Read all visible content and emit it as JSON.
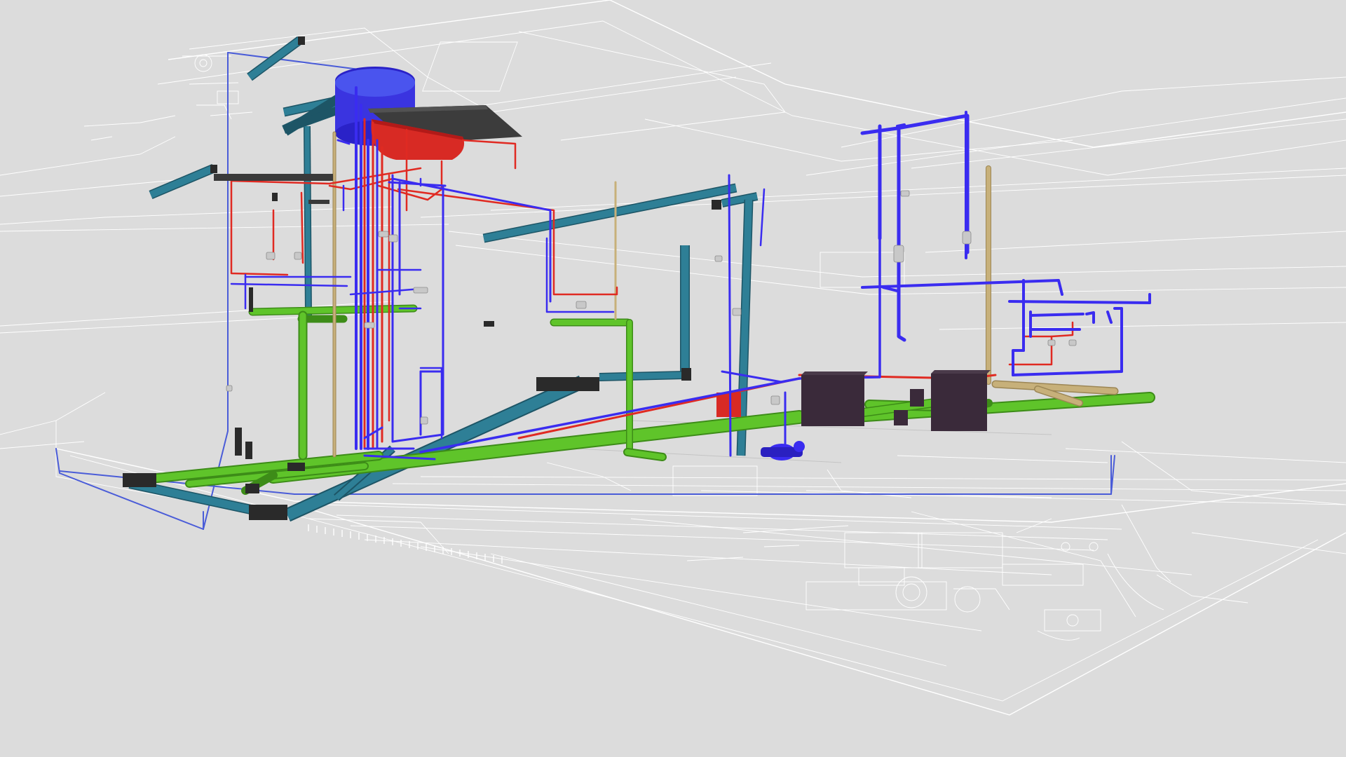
{
  "viewer": {
    "view": "3d-perspective"
  },
  "systems": [
    {
      "key": "drainage",
      "color": "#5fc42a",
      "edge": "#3d8c18"
    },
    {
      "key": "vent",
      "color": "#2e7f96",
      "edge": "#1d5566"
    },
    {
      "key": "cold-water",
      "color": "#3a2cf0",
      "light": "#4a5cd8"
    },
    {
      "key": "hot-water",
      "color": "#e02a22"
    },
    {
      "key": "gas",
      "color": "#c7b07a",
      "edge": "#9c8655"
    }
  ],
  "colors": {
    "background": "#dcdcdc",
    "floorplan_lines": "#ffffff",
    "tank_body": "#3a34e0",
    "tank_top": "#4a54ee",
    "heater": "#d82a24",
    "solar_panel": "#3c3c3c",
    "inspection_box": "#3a2a3a",
    "inspection_box_top": "#4a3a4a"
  },
  "icons": [
    "water-tank-icon",
    "solar-panel-icon",
    "water-heater-icon",
    "pump-icon",
    "inspection-box-icon"
  ]
}
